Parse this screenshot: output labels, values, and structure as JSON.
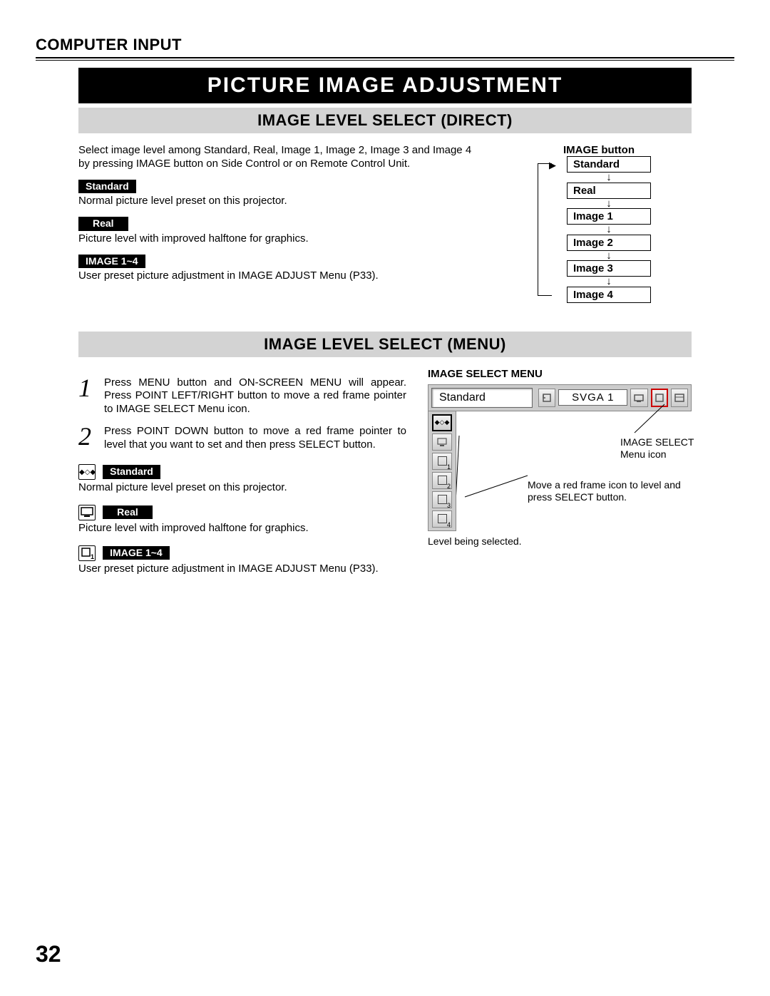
{
  "header": "COMPUTER INPUT",
  "main_title": "PICTURE IMAGE ADJUSTMENT",
  "section1": {
    "title": "IMAGE LEVEL SELECT (DIRECT)",
    "intro": "Select image level among Standard, Real, Image 1, Image 2, Image 3 and Image 4 by pressing IMAGE button on Side Control or on Remote Control Unit.",
    "items": [
      {
        "label": "Standard",
        "desc": "Normal picture level preset on this projector."
      },
      {
        "label": "Real",
        "desc": "Picture level with improved halftone for graphics."
      },
      {
        "label": "IMAGE 1~4",
        "desc": "User preset picture adjustment in IMAGE ADJUST Menu (P33)."
      }
    ],
    "cycle": {
      "title": "IMAGE button",
      "steps": [
        "Standard",
        "Real",
        "Image 1",
        "Image 2",
        "Image 3",
        "Image 4"
      ]
    }
  },
  "section2": {
    "title": "IMAGE LEVEL SELECT (MENU)",
    "steps": [
      {
        "n": "1",
        "text": "Press MENU button and ON-SCREEN MENU will appear.  Press POINT LEFT/RIGHT button to move a red frame pointer to IMAGE SELECT Menu icon."
      },
      {
        "n": "2",
        "text": "Press POINT DOWN button to move a red frame pointer to level that you want to set and then press SELECT button."
      }
    ],
    "items": [
      {
        "label": "Standard",
        "desc": "Normal picture level preset on this projector."
      },
      {
        "label": "Real",
        "desc": "Picture level with improved halftone for graphics."
      },
      {
        "label": "IMAGE 1~4",
        "desc": "User preset picture adjustment in IMAGE ADJUST Menu (P33)."
      }
    ],
    "menu": {
      "title": "IMAGE SELECT MENU",
      "current": "Standard",
      "mode": "SVGA 1",
      "callout_icon": "IMAGE SELECT Menu icon",
      "callout_move": "Move a red frame icon to level and press SELECT button.",
      "callout_selected": "Level being selected."
    }
  },
  "page_number": "32"
}
